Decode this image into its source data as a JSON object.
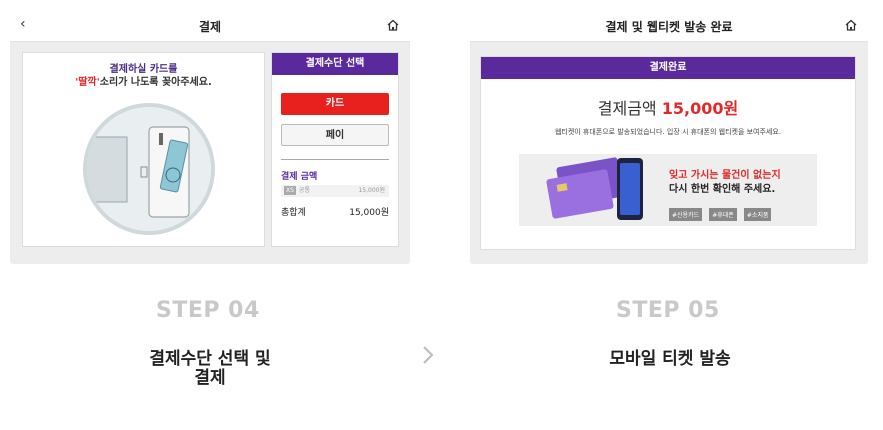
{
  "steps": [
    {
      "screen": {
        "title": "결제",
        "guide_line1": "결제하실 카드를",
        "guide_line2_em": "'딸깍'",
        "guide_line2_rest": "소리가 나도록 꽂아주세요.",
        "pay_header": "결제수단 선택",
        "card_button": "카드",
        "pay_button": "페이",
        "amount_title": "결제 금액",
        "amount_tag": "XS",
        "amount_item": "공통",
        "amount_item_value": "15,000원",
        "total_label": "총합계",
        "total_value": "15,000원"
      },
      "label": "STEP 04",
      "caption_line1": "결제수단 선택 및",
      "caption_line2": "결제"
    },
    {
      "screen": {
        "title": "결제 및 웹티켓 발송 완료",
        "done_header": "결제완료",
        "amount_label": "결제금액",
        "amount_value": "15,000원",
        "message": "웹티켓이 휴대폰으로 발송되었습니다. 입장 시 휴대폰의 웹티켓을 보여주세요.",
        "banner_line1": "잊고 가시는 물건이 없는지",
        "banner_line2": "다시 한번 확인해 주세요.",
        "chips": [
          "#신용카드",
          "#휴대폰",
          "#소지품"
        ]
      },
      "label": "STEP 05",
      "caption": "모바일 티켓 발송"
    }
  ],
  "colors": {
    "purple": "#5a2a9c",
    "red": "#e22929",
    "step_gray": "#c9c9c9"
  },
  "icons": {
    "back": "back-arrow-icon",
    "home": "home-icon",
    "next": "chevron-right-icon"
  }
}
